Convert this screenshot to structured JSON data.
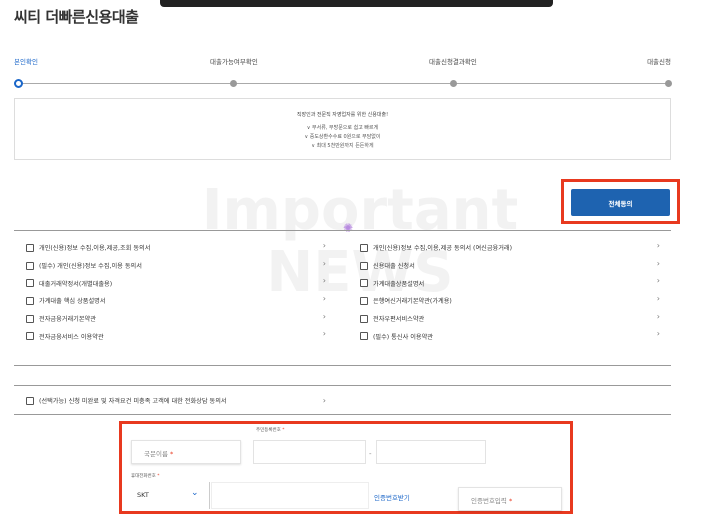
{
  "page": {
    "title": "씨티 더빠른신용대출"
  },
  "steps": [
    {
      "label": "본인확인",
      "active": true
    },
    {
      "label": "대출가능여부확인",
      "active": false
    },
    {
      "label": "대출신청결과확인",
      "active": false
    },
    {
      "label": "대출신청",
      "active": false
    }
  ],
  "info": {
    "title": "직장인과 전문직 자영업자를 위한 신용대출!",
    "lines": [
      "∨ 무서류, 무방문으로 쉽고 빠르게",
      "∨ 중도상환수수료 0원으로 부담없이",
      "∨ 최대 5천만원까지 든든하게"
    ]
  },
  "agree_all": {
    "label": "전체동의"
  },
  "consents_left": [
    "개인(신용)정보 수집,이용,제공,조회 동의서",
    "(필수) 개인(신용)정보 수집,이용 동의서",
    "대출거래약정서(개별대출용)",
    "가계대출 핵심 상품설명서",
    "전자금융거래기본약관",
    "전자금융서비스 이용약관"
  ],
  "consents_right": [
    "개인(신용)정보 수집,이용,제공 동의서 (여신금융거래)",
    "신용대출 신청서",
    "가계대출상품설명서",
    "은행여신거래기본약관(가계용)",
    "전자우편서비스약관",
    "(필수) 통신사 이용약관"
  ],
  "optional_consent": "(선택가능) 신청 미완료 및 자격요건 미충족 고객에 대한 전화상담 동의서",
  "chevron": "›",
  "watermark": {
    "line1": "Important",
    "line2": "NEWS"
  },
  "form": {
    "resident_label": "주민등록번호",
    "name_placeholder": "국문이름",
    "dash": "-",
    "phone_label": "휴대전화번호",
    "required_mark": "*",
    "carrier": "SKT",
    "verify_link": "인증번호받기",
    "code_placeholder": "인증번호입력"
  },
  "icons": {
    "chevron_down": "chevron-down-icon",
    "spinner": "loading-spinner-icon"
  },
  "colors": {
    "accent": "#1a66c9",
    "highlight": "#e8391f",
    "button": "#1e63b0"
  }
}
